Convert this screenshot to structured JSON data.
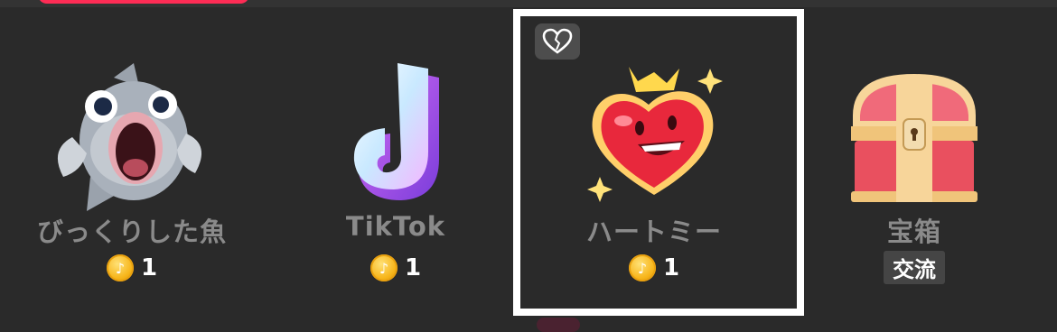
{
  "gifts": [
    {
      "name": "びっくりした魚",
      "price": "1",
      "icon": "surprised-fish-icon"
    },
    {
      "name": "TikTok",
      "price": "1",
      "icon": "tiktok-logo-icon"
    },
    {
      "name": "ハートミー",
      "price": "1",
      "icon": "heart-me-icon",
      "selected": true
    },
    {
      "name": "宝箱",
      "tag": "交流",
      "icon": "treasure-chest-icon"
    }
  ],
  "coin_symbol": "♪",
  "colors": {
    "background": "#2a2a2a",
    "accent": "#fe2c55",
    "selection": "#ffffff",
    "coin": "#f7b51a"
  }
}
